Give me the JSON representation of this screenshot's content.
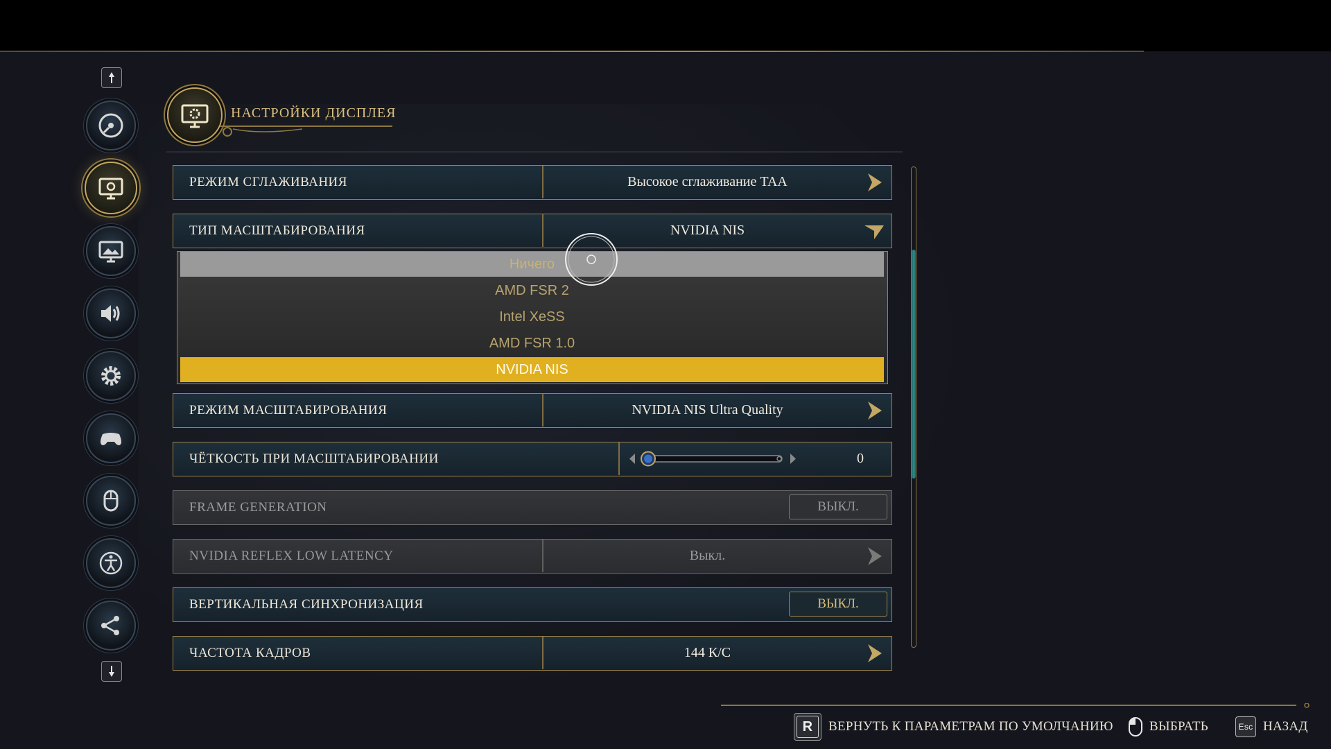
{
  "header": {
    "title": "НАСТРОЙКИ ДИСПЛЕЯ",
    "icon": "monitor-gear-icon"
  },
  "sidebar": {
    "items": [
      {
        "icon": "disc-icon",
        "active": false
      },
      {
        "icon": "display-settings-icon",
        "active": true
      },
      {
        "icon": "monitor-image-icon",
        "active": false
      },
      {
        "icon": "speaker-icon",
        "active": false
      },
      {
        "icon": "gear-icon",
        "active": false
      },
      {
        "icon": "gamepad-icon",
        "active": false
      },
      {
        "icon": "mouse-icon",
        "active": false
      },
      {
        "icon": "accessibility-icon",
        "active": false
      },
      {
        "icon": "network-icon",
        "active": false
      }
    ]
  },
  "settings": {
    "antialiasing": {
      "label": "РЕЖИМ СГЛАЖИВАНИЯ",
      "value": "Высокое сглаживание TAA"
    },
    "upscale_type": {
      "label": "ТИП МАСШТАБИРОВАНИЯ",
      "value": "NVIDIA NIS"
    },
    "upscale_mode": {
      "label": "РЕЖИМ МАСШТАБИРОВАНИЯ",
      "value": "NVIDIA NIS Ultra Quality"
    },
    "sharpness": {
      "label": "ЧЁТКОСТЬ ПРИ МАСШТАБИРОВАНИИ",
      "value": "0",
      "level": 0
    },
    "frame_generation": {
      "label": "FRAME GENERATION",
      "value": "ВЫКЛ.",
      "disabled": true
    },
    "reflex": {
      "label": "NVIDIA REFLEX LOW LATENCY",
      "value": "Выкл.",
      "disabled": true
    },
    "vsync": {
      "label": "ВЕРТИКАЛЬНАЯ СИНХРОНИЗАЦИЯ",
      "value": "ВЫКЛ."
    },
    "framerate": {
      "label": "ЧАСТОТА КАДРОВ",
      "value": "144 К/С"
    }
  },
  "dropdown": {
    "options": [
      "Ничего",
      "AMD FSR 2",
      "Intel XeSS",
      "AMD FSR 1.0",
      "NVIDIA NIS"
    ],
    "hovered": "Ничего",
    "selected": "NVIDIA NIS"
  },
  "footer": {
    "reset": {
      "key": "R",
      "label": "ВЕРНУТЬ К ПАРАМЕТРАМ ПО УМОЛЧАНИЮ"
    },
    "select": {
      "key_icon": "mouse-left-click-icon",
      "label": "ВЫБРАТЬ"
    },
    "back": {
      "key": "Esc",
      "label": "НАЗАД"
    }
  },
  "colors": {
    "gold": "#c4a764",
    "selected_option": "#e0b021",
    "panel": "#1e2f3a",
    "scroll_thumb": "#2f8f8c"
  }
}
